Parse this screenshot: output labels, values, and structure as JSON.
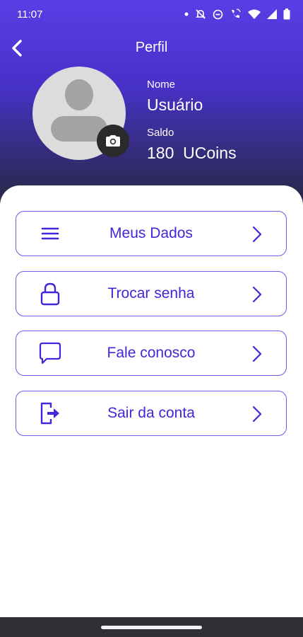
{
  "status_bar": {
    "time": "11:07"
  },
  "header": {
    "title": "Perfil"
  },
  "profile": {
    "name_label": "Nome",
    "name_value": "Usuário",
    "balance_label": "Saldo",
    "balance_value": "180  UCoins"
  },
  "menu": {
    "items": [
      {
        "label": "Meus Dados",
        "icon": "menu-lines-icon"
      },
      {
        "label": "Trocar senha",
        "icon": "lock-icon"
      },
      {
        "label": "Fale conosco",
        "icon": "chat-bubble-icon"
      },
      {
        "label": "Sair da conta",
        "icon": "logout-icon"
      }
    ]
  },
  "colors": {
    "header_gradient_top": "#5a3ee6",
    "header_gradient_bottom": "#262739",
    "accent": "#4326d9",
    "item_border": "#6a5ae6"
  }
}
